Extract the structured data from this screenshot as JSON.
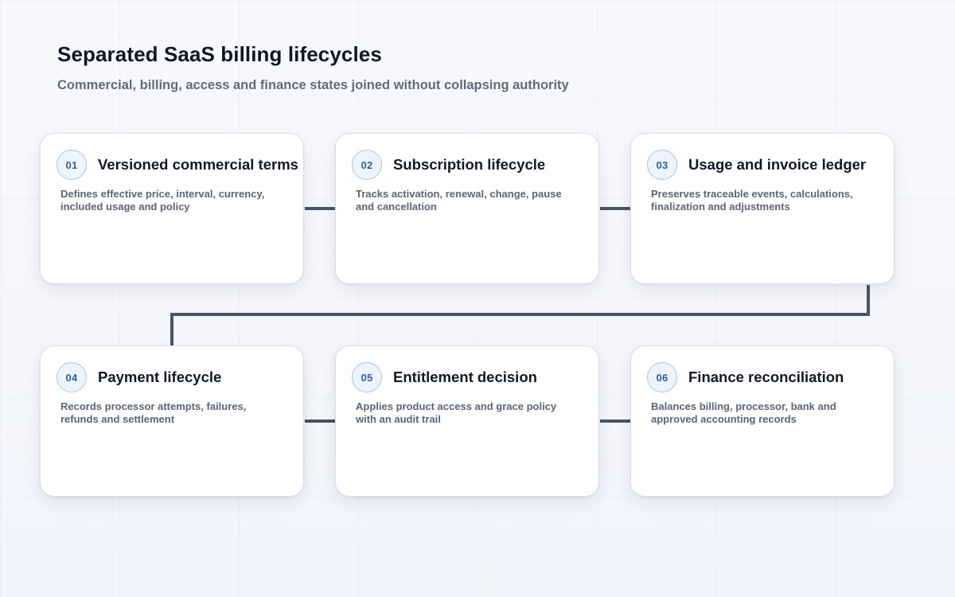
{
  "header": {
    "title": "Separated SaaS billing lifecycles",
    "subtitle": "Commercial, billing, access and finance states joined without collapsing authority"
  },
  "colors": {
    "connector": "#4a5568",
    "badge_border": "#aac2e6",
    "badge_fill": "#eef4fd",
    "badge_text": "#2e5ea8"
  },
  "steps": [
    {
      "number": "01",
      "title": "Versioned commercial terms",
      "description": "Defines effective price, interval, currency, included usage and policy"
    },
    {
      "number": "02",
      "title": "Subscription lifecycle",
      "description": "Tracks activation, renewal, change, pause and cancellation"
    },
    {
      "number": "03",
      "title": "Usage and invoice ledger",
      "description": "Preserves traceable events, calculations, finalization and adjustments"
    },
    {
      "number": "04",
      "title": "Payment lifecycle",
      "description": "Records processor attempts, failures, refunds and settlement"
    },
    {
      "number": "05",
      "title": "Entitlement decision",
      "description": "Applies product access and grace policy with an audit trail"
    },
    {
      "number": "06",
      "title": "Finance reconciliation",
      "description": "Balances billing, processor, bank and approved accounting records"
    }
  ]
}
